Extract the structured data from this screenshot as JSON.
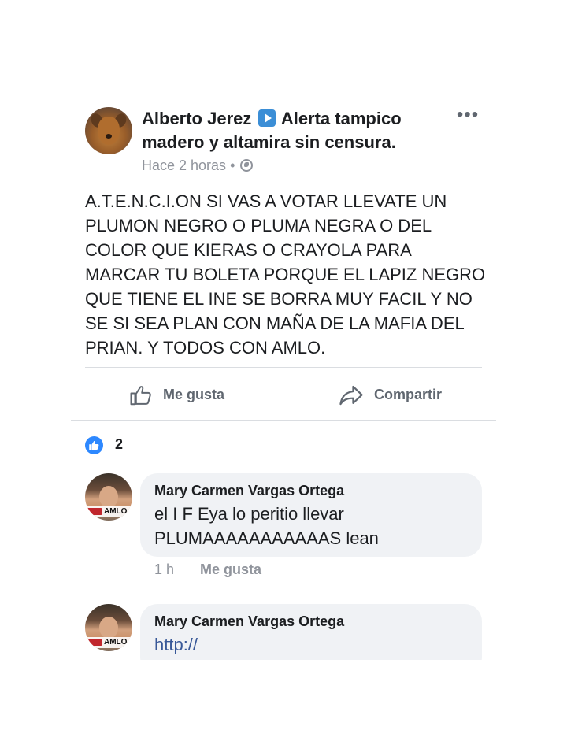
{
  "post": {
    "author": "Alberto Jerez",
    "group": "Alerta tampico madero y altamira sin censura.",
    "time": "Hace 2 horas",
    "separator": "•",
    "more_label": "•••",
    "body": "A.T.E.N.C.I.ON SI VAS A VOTAR LLEVATE UN PLUMON NEGRO O PLUMA NEGRA O DEL COLOR QUE KIERAS O CRAYOLA PARA MARCAR TU BOLETA PORQUE EL LAPIZ NEGRO QUE TIENE EL INE SE BORRA MUY FACIL Y NO SE SI SEA PLAN CON MAÑA DE LA MAFIA DEL PRIAN. Y TODOS CON AMLO."
  },
  "actions": {
    "like_label": "Me gusta",
    "share_label": "Compartir"
  },
  "reactions": {
    "count": "2"
  },
  "comments": [
    {
      "author": "Mary Carmen Vargas Ortega",
      "text": "el    I F Eya lo peritio llevar PLUMAAAAAAAAAAAS    lean",
      "time": "1 h",
      "like_label": "Me gusta",
      "avatar_badge": "AMLO"
    },
    {
      "author": "Mary Carmen Vargas Ortega",
      "link": "http://",
      "avatar_badge": "AMLO"
    }
  ],
  "colors": {
    "accent": "#2d88ff",
    "link": "#385898",
    "muted": "#90949c",
    "bubble": "#f0f2f5"
  },
  "icons": [
    "dog-avatar-icon",
    "play-icon",
    "globe-icon",
    "more-icon",
    "thumbs-up-icon",
    "share-arrow-icon",
    "like-reaction-icon"
  ]
}
